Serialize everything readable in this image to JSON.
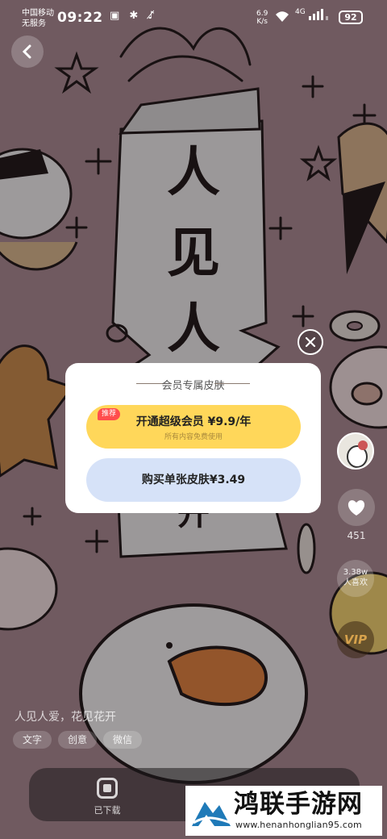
{
  "status_bar": {
    "carrier": "中国移动",
    "service": "无服务",
    "time": "09:22",
    "icons": "▣ ✱ ♪̸",
    "net_speed_value": "6.9",
    "net_speed_unit": "K/s",
    "signal": "4G",
    "battery": "92"
  },
  "wallpaper": {
    "banner_chars": [
      "人",
      "见",
      "人"
    ],
    "bottom_char": "开"
  },
  "modal": {
    "title": "会员专属皮肤",
    "vip_tag": "推荐",
    "vip_label": "开通超级会员 ¥9.9/年",
    "vip_sub": "所有内容免费使用",
    "single_label": "购买单张皮肤¥3.49"
  },
  "side": {
    "like_count": "451",
    "fans_count": "3.38w",
    "fans_label": "人喜欢",
    "vip_badge": "VIP"
  },
  "caption": "人见人爱，花见花开",
  "tags": [
    "文字",
    "创意",
    "微信"
  ],
  "bottom": {
    "downloaded_label": "已下载"
  },
  "watermark": {
    "title": "鸿联手游网",
    "url": "www.henanhonglian95.com"
  },
  "colors": {
    "vip_button": "#ffd75a",
    "single_button": "#d6e2f8",
    "tag_red": "#ff4d4d"
  }
}
